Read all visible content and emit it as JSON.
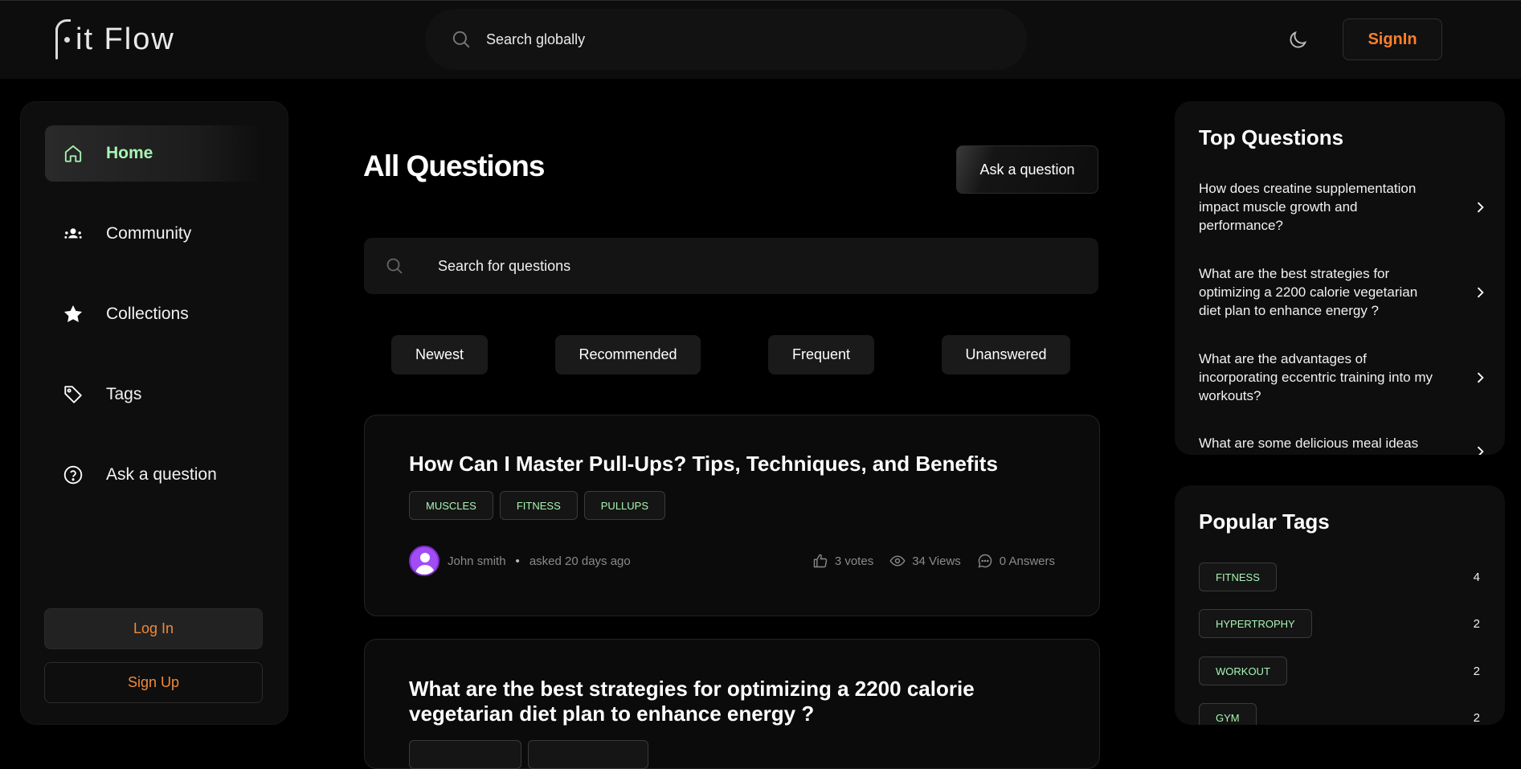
{
  "navbar": {
    "logo_text": "it Flow",
    "search_placeholder": "Search globally",
    "signin_label": "SignIn",
    "theme_icon": "moon-icon"
  },
  "sidebar": {
    "items": [
      {
        "label": "Home",
        "icon": "home-icon",
        "active": true
      },
      {
        "label": "Community",
        "icon": "community-icon",
        "active": false
      },
      {
        "label": "Collections",
        "icon": "star-icon",
        "active": false
      },
      {
        "label": "Tags",
        "icon": "tag-icon",
        "active": false
      },
      {
        "label": "Ask a question",
        "icon": "question-icon",
        "active": false
      }
    ],
    "login_label": "Log In",
    "signup_label": "Sign Up"
  },
  "main": {
    "title": "All Questions",
    "ask_button": "Ask a question",
    "search_placeholder": "Search for questions",
    "filters": [
      "Newest",
      "Recommended",
      "Frequent",
      "Unanswered"
    ],
    "questions": [
      {
        "title": "How Can I Master Pull-Ups? Tips, Techniques, and Benefits",
        "tags": [
          "MUSCLES",
          "FITNESS",
          "PULLUPS"
        ],
        "author": "John smith",
        "asked": "asked 20 days ago",
        "votes": "3 votes",
        "views": "34 Views",
        "answers": "0 Answers"
      },
      {
        "title": "What are the best strategies for optimizing a 2200 calorie vegetarian diet plan to enhance energy ?",
        "tags": [],
        "author": "",
        "asked": "",
        "votes": "",
        "views": "",
        "answers": ""
      }
    ]
  },
  "top_questions": {
    "title": "Top Questions",
    "items": [
      "How does creatine supplementation impact muscle growth and performance?",
      "What are the best strategies for optimizing a 2200 calorie vegetarian diet plan to enhance energy ?",
      "What are the advantages of incorporating eccentric training into my workouts?",
      "What are some delicious meal ideas"
    ]
  },
  "popular_tags": {
    "title": "Popular Tags",
    "items": [
      {
        "name": "FITNESS",
        "count": "4"
      },
      {
        "name": "HYPERTROPHY",
        "count": "2"
      },
      {
        "name": "WORKOUT",
        "count": "2"
      },
      {
        "name": "GYM",
        "count": "2"
      }
    ]
  },
  "colors": {
    "accent_green": "#a8f5b4",
    "accent_orange": "#ff7f2a",
    "avatar_purple": "#a24cf5"
  }
}
